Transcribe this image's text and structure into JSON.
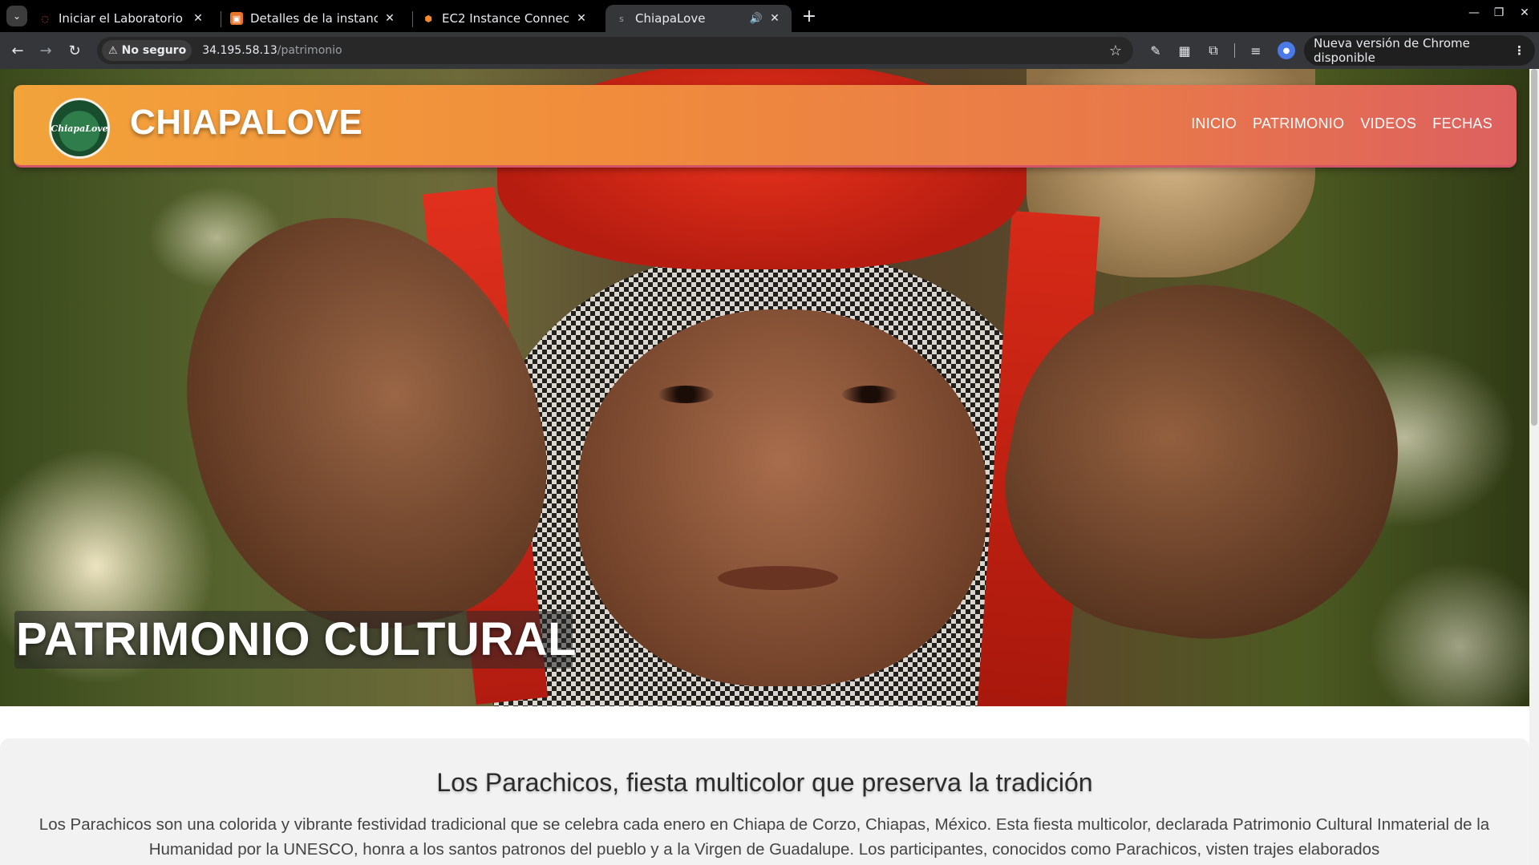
{
  "browser": {
    "tabs": [
      {
        "title": "Iniciar el Laboratorio de",
        "favicon": "loading-ring-icon",
        "active": false
      },
      {
        "title": "Detalles de la instancia |",
        "favicon": "aws-console-icon",
        "active": false
      },
      {
        "title": "EC2 Instance Connect | u",
        "favicon": "aws-hexagon-icon",
        "active": false
      },
      {
        "title": "ChiapaLove",
        "favicon": "page-favicon",
        "active": true,
        "audio": true
      }
    ],
    "security_label": "No seguro",
    "url_host": "34.195.58.13",
    "url_path": "/patrimonio",
    "update_label": "Nueva versión de Chrome disponible"
  },
  "site": {
    "brand": "CHIAPALOVE",
    "logo_text": "ChiapaLove",
    "nav": [
      "INICIO",
      "PATRIMONIO",
      "VIDEOS",
      "FECHAS"
    ]
  },
  "hero": {
    "title": "PATRIMONIO CULTURAL"
  },
  "article": {
    "heading": "Los Parachicos, fiesta multicolor que preserva la tradición",
    "body": "Los Parachicos son una colorida y vibrante festividad tradicional que se celebra cada enero en Chiapa de Corzo, Chiapas, México. Esta fiesta multicolor, declarada Patrimonio Cultural Inmaterial de la Humanidad por la UNESCO, honra a los santos patronos del pueblo y a la Virgen de Guadalupe. Los participantes, conocidos como Parachicos, visten trajes elaborados"
  },
  "colors": {
    "header_start": "#f2a33a",
    "header_end": "#dd6060",
    "tab_active": "#35363a",
    "toolbar": "#35363a"
  }
}
